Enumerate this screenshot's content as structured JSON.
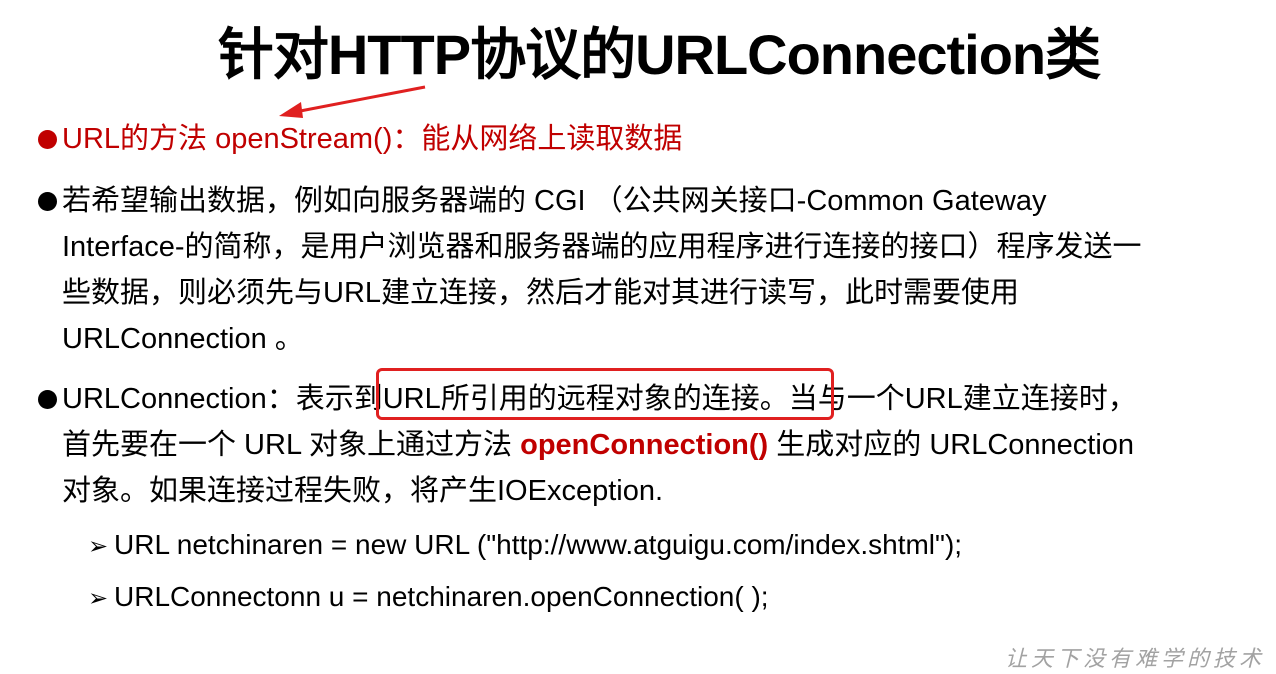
{
  "title": "针对HTTP协议的URLConnection类",
  "bullet1": {
    "text": "URL的方法 openStream()：能从网络上读取数据",
    "color": "#c00000"
  },
  "bullet2": {
    "line1": "若希望输出数据，例如向服务器端的 CGI （公共网关接口-Common Gateway",
    "line2": "Interface-的简称，是用户浏览器和服务器端的应用程序进行连接的接口）程序发送一",
    "line3": "些数据，则必须先与URL建立连接，然后才能对其进行读写，此时需要使用",
    "line4": "URLConnection 。"
  },
  "bullet3": {
    "line1": "URLConnection：表示到URL所引用的远程对象的连接。当与一个URL建立连接时，",
    "line2_before": "首先要在一个 URL 对象上通过方法 ",
    "line2_bold": "openConnection()",
    "line2_after": " 生成对应的 URLConnection",
    "line3": "对象。如果连接过程失败，将产生IOException."
  },
  "code": {
    "line1": "URL netchinaren = new URL (\"http://www.atguigu.com/index.shtml\");",
    "line2": "URLConnectonn u = netchinaren.openConnection( );"
  },
  "watermark": "让天下没有难学的技术",
  "colors": {
    "accent_red": "#c00000",
    "annotation_red": "#e02020"
  }
}
